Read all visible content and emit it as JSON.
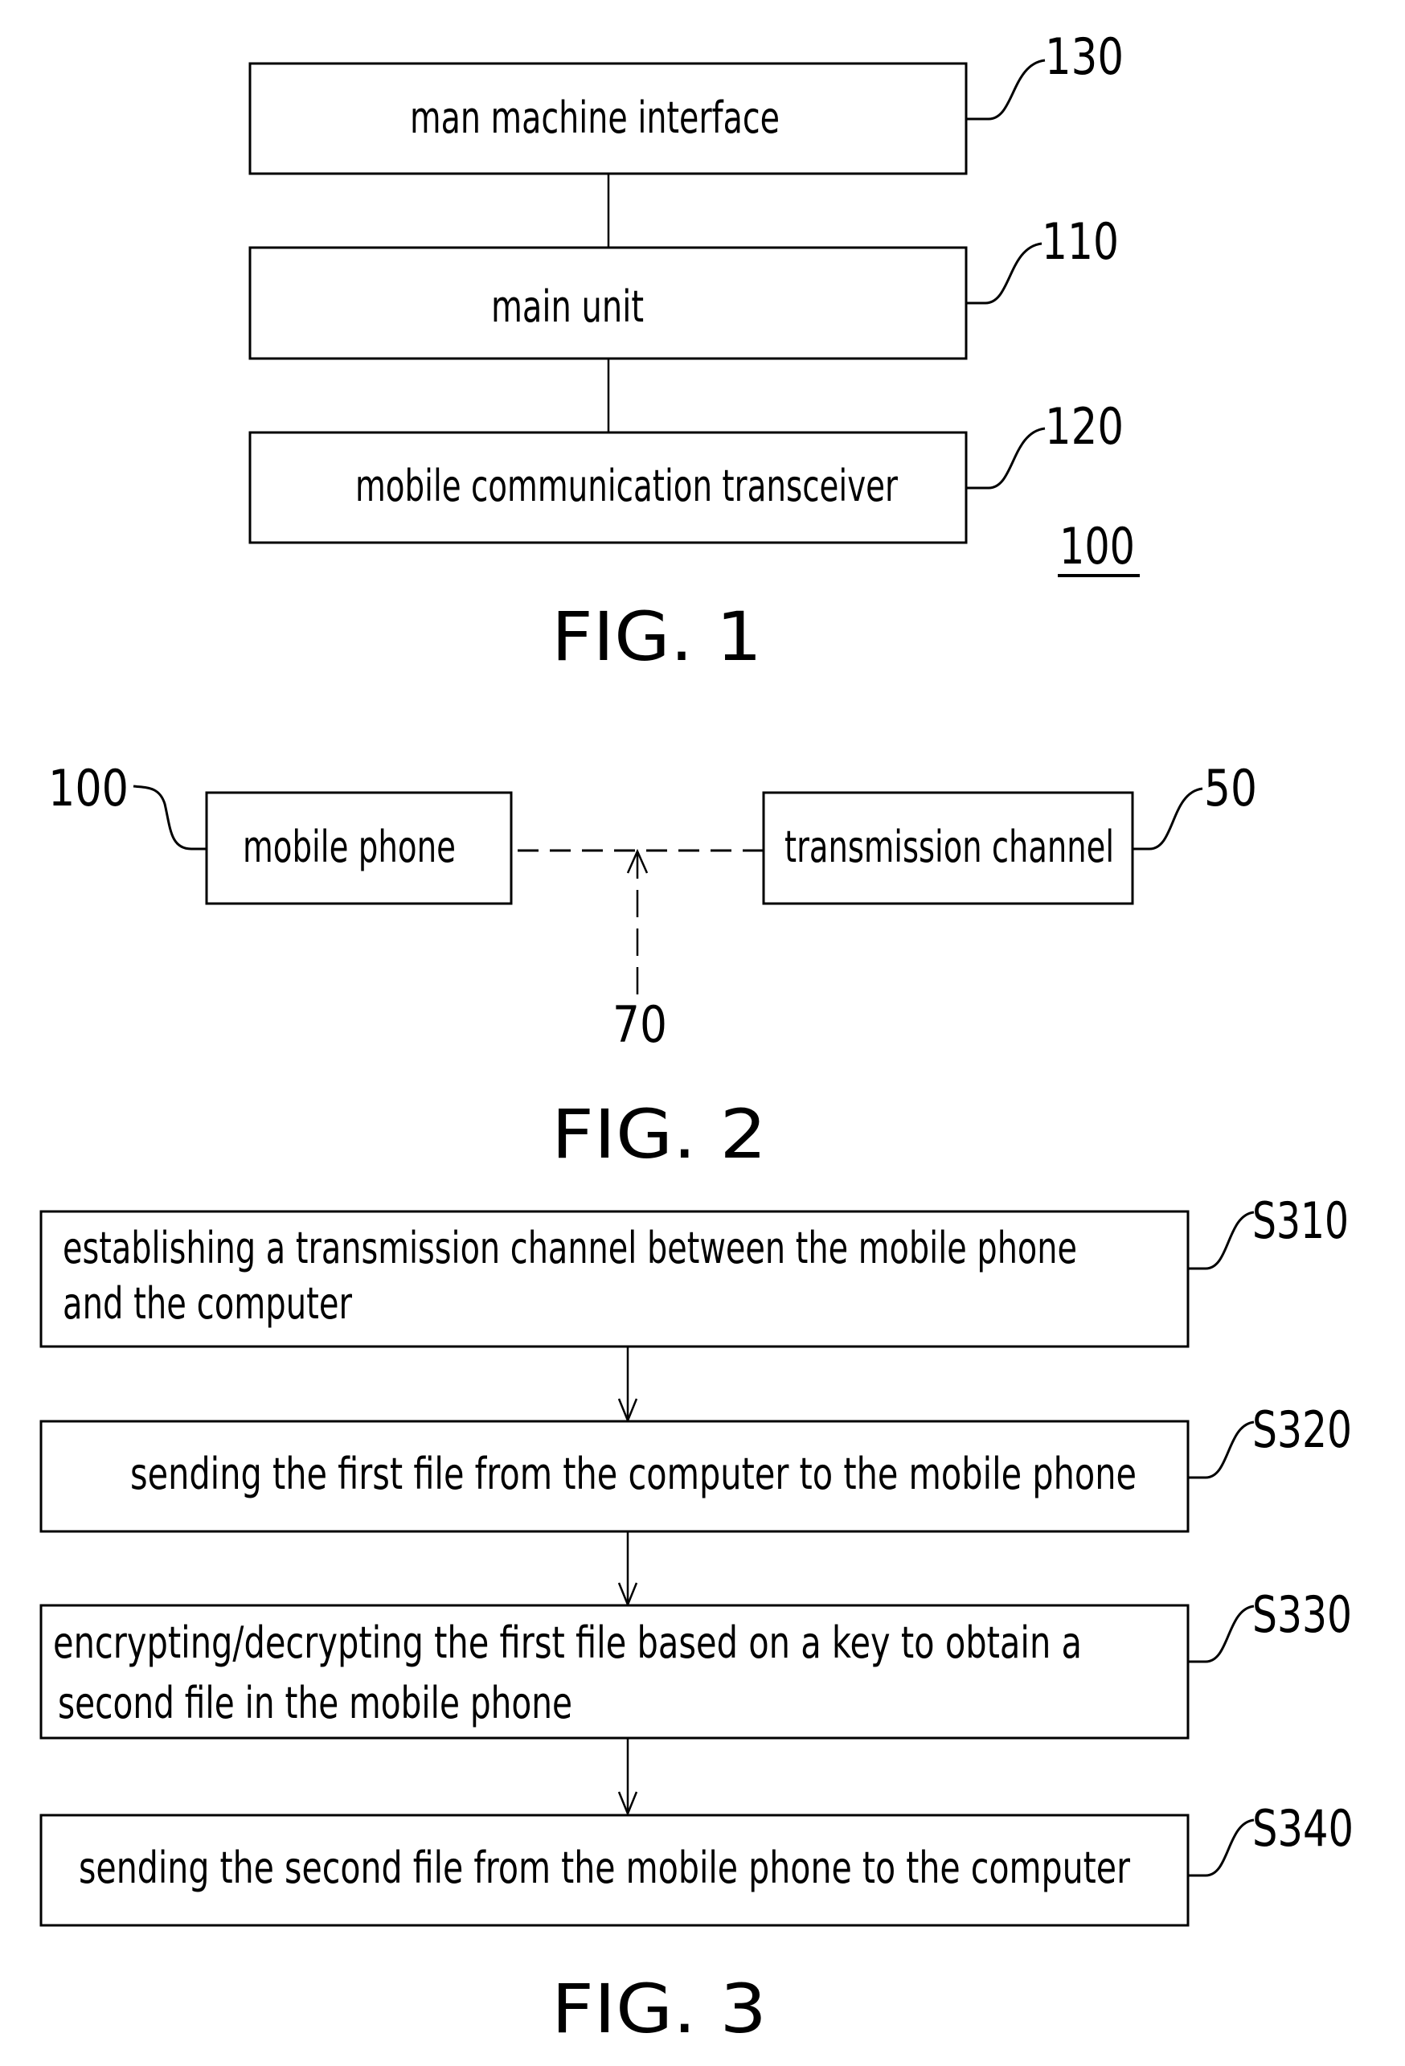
{
  "fig1": {
    "caption": "FIG. 1",
    "assembly_ref": "100",
    "blocks": [
      {
        "ref": "130",
        "label": "man machine interface"
      },
      {
        "ref": "110",
        "label": "main unit"
      },
      {
        "ref": "120",
        "label": "mobile communication transceiver"
      }
    ]
  },
  "fig2": {
    "caption": "FIG. 2",
    "blocks": [
      {
        "ref": "100",
        "label": "mobile phone"
      },
      {
        "ref": "50",
        "label": "transmission channel"
      }
    ],
    "link_ref": "70"
  },
  "fig3": {
    "caption": "FIG. 3",
    "steps": [
      {
        "ref": "S310",
        "lines": [
          "establishing a transmission channel between the mobile phone",
          "and the computer"
        ]
      },
      {
        "ref": "S320",
        "lines": [
          "sending the first file from the computer to the mobile phone"
        ]
      },
      {
        "ref": "S330",
        "lines": [
          "encrypting/decrypting the first file based on a key to obtain a",
          "second file in the mobile phone"
        ]
      },
      {
        "ref": "S340",
        "lines": [
          "sending the second file from the mobile phone to the computer"
        ]
      }
    ]
  }
}
